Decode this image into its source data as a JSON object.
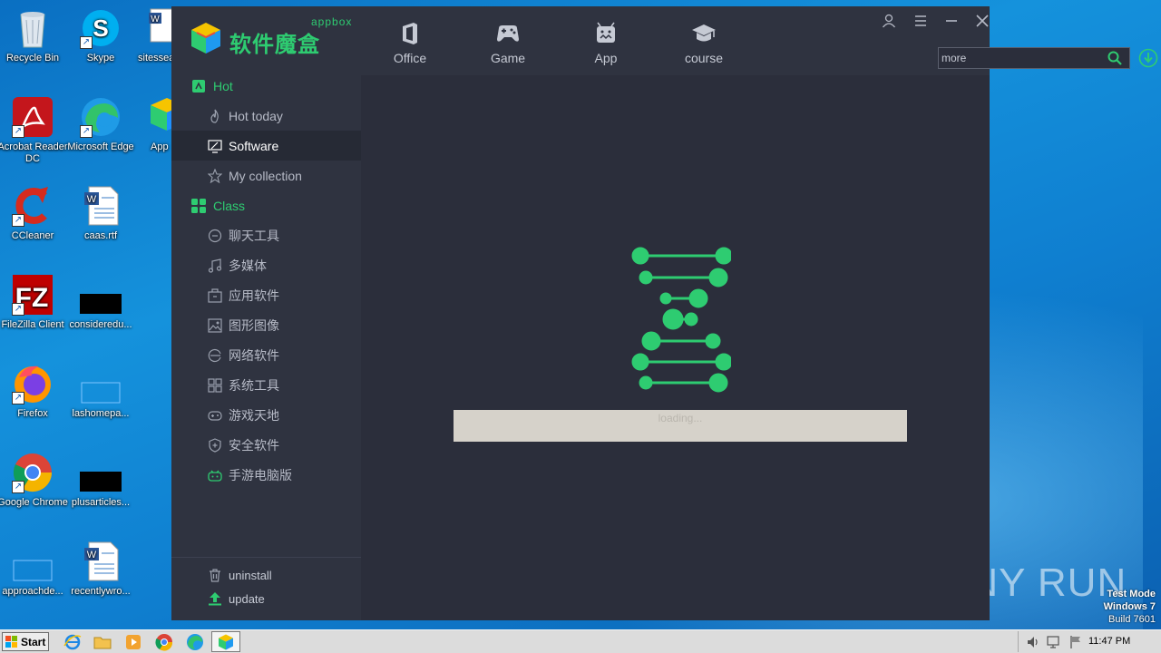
{
  "desktop": {
    "icons": [
      {
        "label": "Recycle Bin"
      },
      {
        "label": "Skype"
      },
      {
        "label": "sitessea"
      },
      {
        "label": "Acrobat Reader DC"
      },
      {
        "label": "Microsoft Edge"
      },
      {
        "label": "App"
      },
      {
        "label": "CCleaner"
      },
      {
        "label": "caas.rtf"
      },
      {
        "label": "FileZilla Client"
      },
      {
        "label": "consideredu..."
      },
      {
        "label": "Firefox"
      },
      {
        "label": "lashomepa..."
      },
      {
        "label": "Google Chrome"
      },
      {
        "label": "plusarticles..."
      },
      {
        "label": "approachde..."
      },
      {
        "label": "recentlywro..."
      }
    ]
  },
  "app": {
    "logo_text": "软件魔盒",
    "logo_sub": "appbox",
    "tabs": [
      {
        "label": "Office",
        "icon": "office-icon"
      },
      {
        "label": "Game",
        "icon": "gamepad-icon"
      },
      {
        "label": "App",
        "icon": "android-icon"
      },
      {
        "label": "course",
        "icon": "graduation-cap-icon"
      }
    ],
    "search": {
      "value": "more"
    },
    "sidebar": {
      "hot_header": "Hot",
      "hot_items": [
        {
          "label": "Hot today",
          "icon": "flame-icon"
        },
        {
          "label": "Software",
          "icon": "monitor-icon"
        },
        {
          "label": "My collection",
          "icon": "star-icon"
        }
      ],
      "class_header": "Class",
      "class_items": [
        {
          "label": "聊天工具",
          "icon": "chat-icon"
        },
        {
          "label": "多媒体",
          "icon": "music-note-icon"
        },
        {
          "label": "应用软件",
          "icon": "toolbox-icon"
        },
        {
          "label": "图形图像",
          "icon": "image-icon"
        },
        {
          "label": "网络软件",
          "icon": "browser-icon"
        },
        {
          "label": "系统工具",
          "icon": "windows-icon"
        },
        {
          "label": "游戏天地",
          "icon": "gamepad-icon"
        },
        {
          "label": "安全软件",
          "icon": "shield-icon"
        },
        {
          "label": "手游电脑版",
          "icon": "mobile-game-icon"
        }
      ],
      "uninstall": "uninstall",
      "update": "update"
    },
    "loading_text": "loading...",
    "accent_color": "#2ecc71"
  },
  "watermark": {
    "brand": "ANY RUN",
    "line1": "Test Mode",
    "line2": "Windows 7",
    "line3": "Build 7601"
  },
  "taskbar": {
    "start_label": "Start",
    "clock": "11:47 PM"
  }
}
